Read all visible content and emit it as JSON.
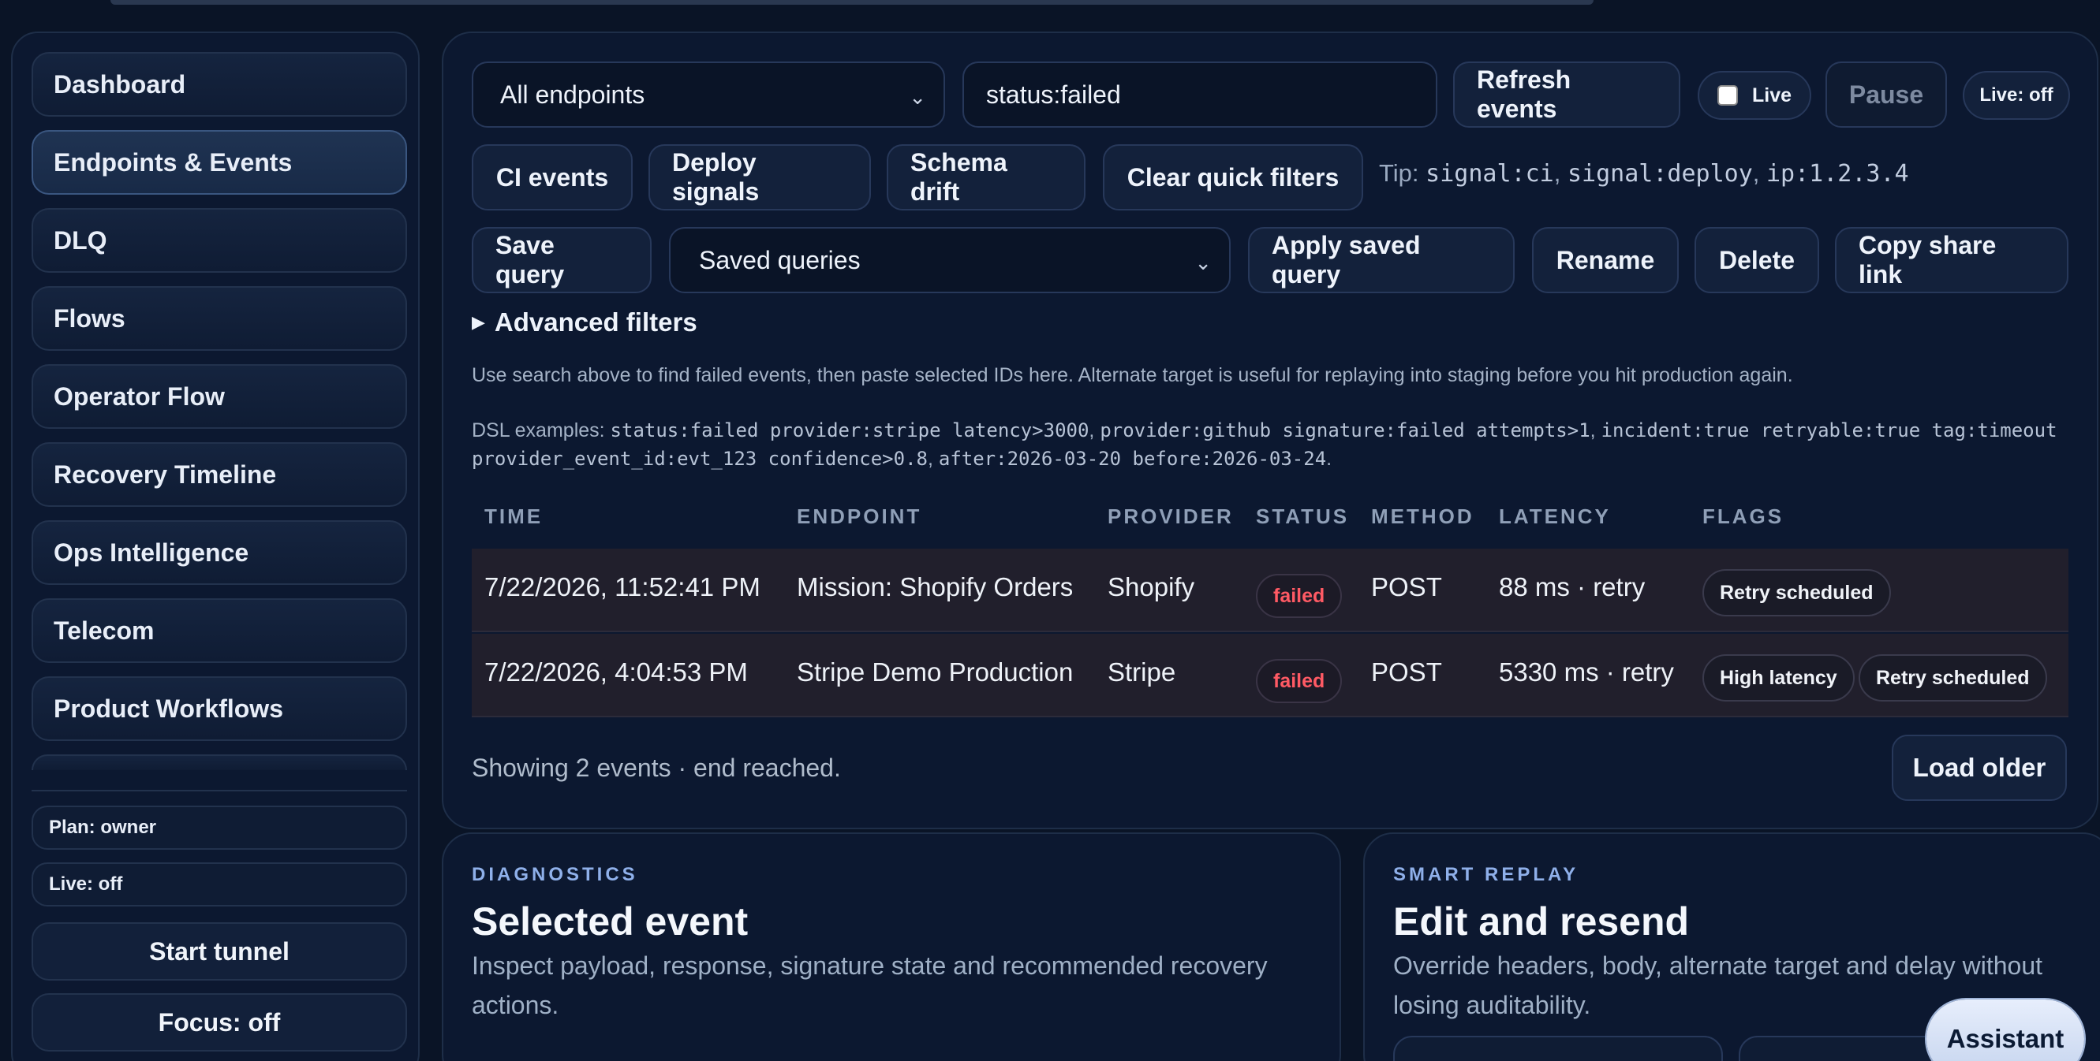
{
  "sidebar": {
    "nav": [
      "Dashboard",
      "Endpoints & Events",
      "DLQ",
      "Flows",
      "Operator Flow",
      "Recovery Timeline",
      "Ops Intelligence",
      "Telecom",
      "Product Workflows"
    ],
    "active": "Endpoints & Events",
    "plan": "Plan: owner",
    "live": "Live: off",
    "start_tunnel": "Start tunnel",
    "focus": "Focus: off"
  },
  "toolbar": {
    "endpoint_select": "All endpoints",
    "search_value": "status:failed",
    "refresh": "Refresh events",
    "live_checkbox_label": "Live",
    "pause": "Pause",
    "live_status": "Live: off"
  },
  "quick_filters": {
    "ci": "CI events",
    "deploy": "Deploy signals",
    "schema": "Schema drift",
    "clear": "Clear quick filters",
    "tip_prefix": "Tip:",
    "tip_1": "signal:ci",
    "tip_2": "signal:deploy",
    "tip_3": "ip:1.2.3.4"
  },
  "saved": {
    "save": "Save query",
    "select": "Saved queries",
    "apply": "Apply saved query",
    "rename": "Rename",
    "delete": "Delete",
    "share": "Copy share link"
  },
  "advanced": {
    "label": "Advanced filters",
    "help": "Use search above to find failed events, then paste selected IDs here. Alternate target is useful for replaying into staging before you hit production again.",
    "dsl_prefix": "DSL examples:",
    "dsl_1": "status:failed provider:stripe latency>3000",
    "dsl_2": "provider:github signature:failed attempts>1",
    "dsl_3": "incident:true retryable:true tag:timeout",
    "dsl_4": "provider_event_id:evt_123 confidence>0.8",
    "dsl_5": "after:2026-03-20 before:2026-03-24"
  },
  "table": {
    "headers": [
      "TIME",
      "ENDPOINT",
      "PROVIDER",
      "STATUS",
      "METHOD",
      "LATENCY",
      "FLAGS"
    ],
    "rows": [
      {
        "time": "7/22/2026, 11:52:41 PM",
        "endpoint": "Mission: Shopify Orders",
        "provider": "Shopify",
        "status": "failed",
        "method": "POST",
        "latency": "88 ms · retry",
        "flags": [
          "Retry scheduled"
        ]
      },
      {
        "time": "7/22/2026, 4:04:53 PM",
        "endpoint": "Stripe Demo Production",
        "provider": "Stripe",
        "status": "failed",
        "method": "POST",
        "latency": "5330 ms · retry",
        "flags": [
          "High latency",
          "Retry scheduled"
        ]
      }
    ],
    "footer": "Showing 2 events · end reached.",
    "load_older": "Load older"
  },
  "diagnostics": {
    "eyebrow": "DIAGNOSTICS",
    "title": "Selected event",
    "desc": "Inspect payload, response, signature state and recommended recovery actions."
  },
  "smart_replay": {
    "eyebrow": "SMART REPLAY",
    "title": "Edit and resend",
    "desc": "Override headers, body, alternate target and delay without losing auditability."
  },
  "assistant": "Assistant",
  "colors": {
    "background": "#0a1426",
    "panel": "#0c1830",
    "failed": "#ff5a64",
    "accent": "#8fb0ea"
  }
}
